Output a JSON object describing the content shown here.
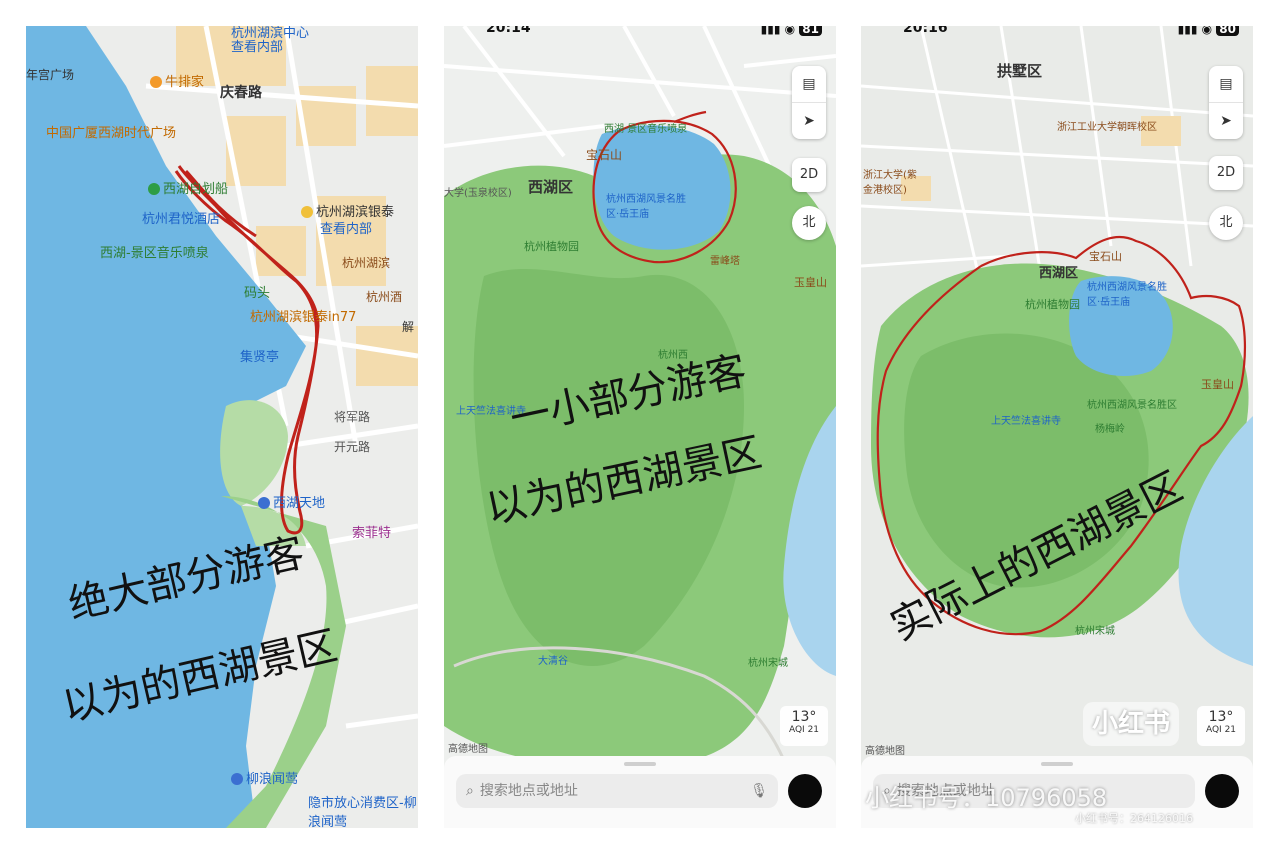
{
  "panel1": {
    "labels": {
      "hubin_center": "杭州湖滨中心",
      "view_inside_1": "查看内部",
      "gong_plaza": "年宫广场",
      "niupai": "牛排家",
      "qingchun_rd": "庆春路",
      "guangsha": "中国广厦西湖时代广场",
      "self_boat": "西湖自划船",
      "junyue": "杭州君悦酒店",
      "hubin_yintai": "杭州湖滨银泰",
      "view_inside_2": "查看内部",
      "music_fountain": "西湖-景区音乐喷泉",
      "matou": "码头",
      "hubin_in77": "杭州湖滨银泰in77",
      "jixian": "集贤亭",
      "xihu_tiandi": "西湖天地",
      "sofitel": "索菲特",
      "liulang_wenying": "柳浪闻莺",
      "yinshi_market": "隐市放心消费区-柳浪闻莺",
      "jiefang": "解",
      "jiangshu_rd": "将军路",
      "kaiyuan_rd": "开元路",
      "hangzhou_jiu": "杭州酒",
      "hubin_short": "杭州湖滨"
    },
    "handwriting": {
      "line1": "绝大部分游客",
      "line2": "以为的西湖景区"
    }
  },
  "panel2": {
    "status_time": "20:14",
    "status_battery": "81",
    "labels": {
      "district": "西湖区",
      "baoshi": "宝石山",
      "botanic": "杭州植物园",
      "scenic": "杭州西湖风景名胜区·岳王庙",
      "music_fountain": "西湖·景区音乐喷泉",
      "leifeng": "雷峰塔",
      "yuhuang": "玉皇山",
      "univ": "大学(玉泉校区)",
      "songcheng": "杭州宋城",
      "daqing": "大清谷",
      "tianzhu": "上天竺法喜讲寺",
      "xihu_short": "杭州西"
    },
    "controls": {
      "mode_2d": "2D",
      "compass": "北",
      "temperature": "13°",
      "aqi": "AQI 21",
      "attribution": "高德地图"
    },
    "search": {
      "placeholder": "搜索地点或地址"
    },
    "handwriting": {
      "line1": "一小部分游客",
      "line2": "以为的西湖景区"
    }
  },
  "panel3": {
    "status_time": "20:16",
    "status_battery": "80",
    "labels": {
      "gongshu": "拱墅区",
      "district": "西湖区",
      "baoshi": "宝石山",
      "botanic": "杭州植物园",
      "scenic": "杭州西湖风景名胜区·岳王庙",
      "scenic2": "杭州西湖风景名胜区",
      "yuhuang": "玉皇山",
      "tianzhu": "上天竺法喜讲寺",
      "meijiawu": "杨梅岭",
      "songcheng": "杭州宋城",
      "zjut": "浙江工业大学朝晖校区",
      "zju": "浙江大学(紫金港校区)"
    },
    "controls": {
      "mode_2d": "2D",
      "compass": "北",
      "temperature": "13°",
      "aqi": "AQI 21",
      "attribution": "高德地图"
    },
    "search": {
      "placeholder": "搜索地点或地址"
    },
    "handwriting": {
      "line1": "实际上的西湖景区"
    },
    "watermark": {
      "logo": "小红书",
      "main": "小红书号：10796058",
      "small": "小红书号：264126016"
    }
  },
  "colors": {
    "lake": "#6fb7e3",
    "forest": "#8cc97a",
    "city": "#eeeeea",
    "building": "#f2d9a8",
    "red_outline": "#c0221b",
    "river": "#a9d4ee"
  }
}
